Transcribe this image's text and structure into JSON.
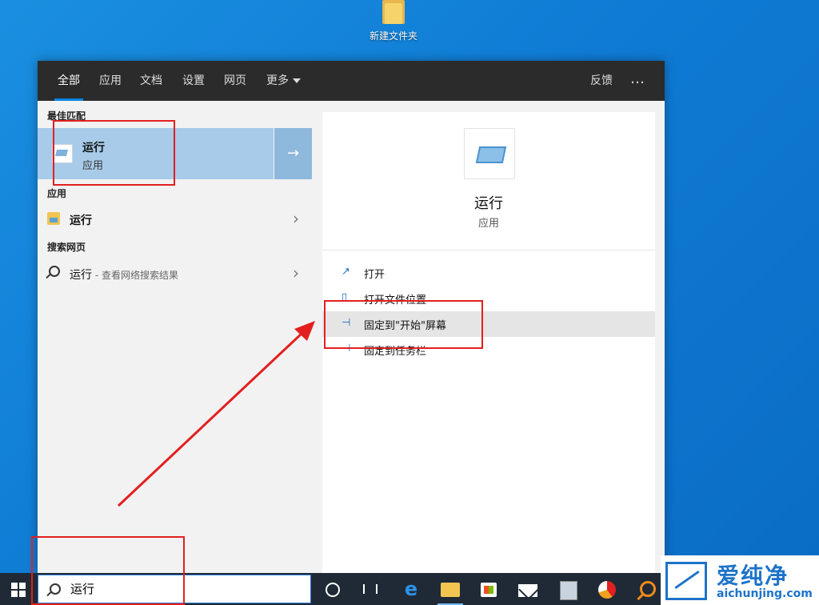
{
  "desktop": {
    "folder_label": "新建文件夹"
  },
  "topbar": {
    "tabs": [
      "全部",
      "应用",
      "文档",
      "设置",
      "网页",
      "更多"
    ],
    "feedback": "反馈",
    "more_icon": "…"
  },
  "left": {
    "best_match_heading": "最佳匹配",
    "best_match": {
      "title": "运行",
      "subtitle": "应用"
    },
    "apps_heading": "应用",
    "app_item": "运行",
    "web_heading": "搜索网页",
    "web_item": {
      "title": "运行",
      "suffix": " - 查看网络搜索结果"
    }
  },
  "right": {
    "app_name": "运行",
    "app_type": "应用",
    "actions": [
      "打开",
      "打开文件位置",
      "固定到\"开始\"屏幕",
      "固定到任务栏"
    ]
  },
  "taskbar": {
    "search_value": "运行"
  },
  "watermark": {
    "title": "爱纯净",
    "url": "aichunjing.com"
  },
  "colors": {
    "accent": "#0a84e0",
    "highlight": "#e31f1f"
  }
}
